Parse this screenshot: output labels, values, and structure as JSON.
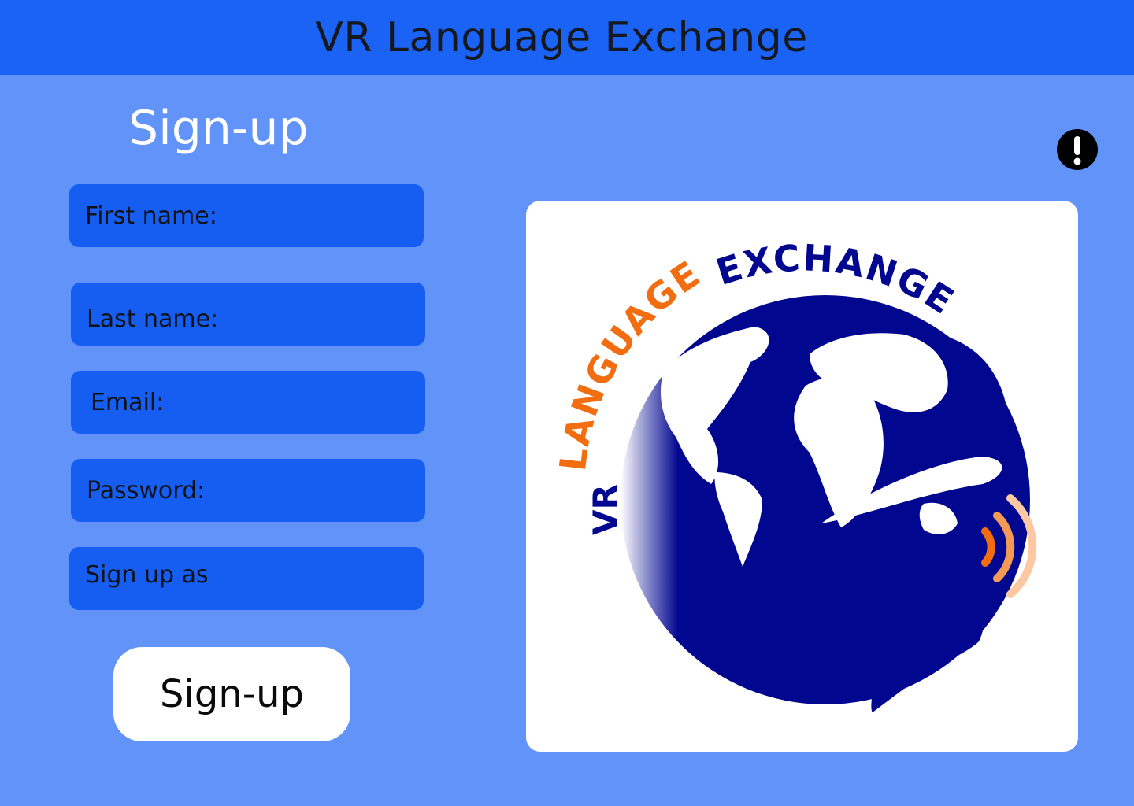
{
  "header": {
    "title": "VR Language Exchange"
  },
  "form": {
    "title": "Sign-up",
    "fields": {
      "first_name": "First name:",
      "last_name": "Last name:",
      "email": "Email:",
      "password": "Password:",
      "sign_up_as": "Sign up as"
    },
    "submit_label": "Sign-up"
  },
  "logo": {
    "text_vr": "VR",
    "text_language": "LANGUAGE",
    "text_exchange": "EXCHANGE"
  },
  "icons": {
    "alert": "exclamation-circle-icon"
  },
  "colors": {
    "header_bg": "#1a63f4",
    "page_bg": "#6193f9",
    "field_bg": "#165ef2",
    "logo_navy": "#02078f",
    "logo_orange": "#f26d10"
  }
}
